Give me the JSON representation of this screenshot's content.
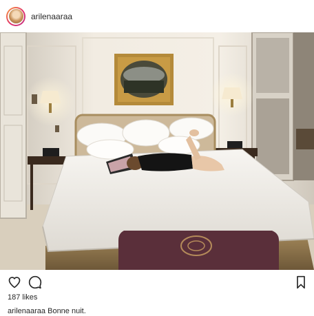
{
  "post": {
    "username": "arilenaaraa",
    "likes": "187 likes",
    "caption_user": "arilenaaraa",
    "caption_text": "Bonne nuit."
  },
  "icons": {
    "avatar": "profile-avatar",
    "like": "heart-icon",
    "comment": "comment-icon",
    "save": "bookmark-icon"
  },
  "colors": {
    "text": "#262626",
    "avatar_ring_start": "#f9a13a",
    "avatar_ring_end": "#c13584"
  }
}
